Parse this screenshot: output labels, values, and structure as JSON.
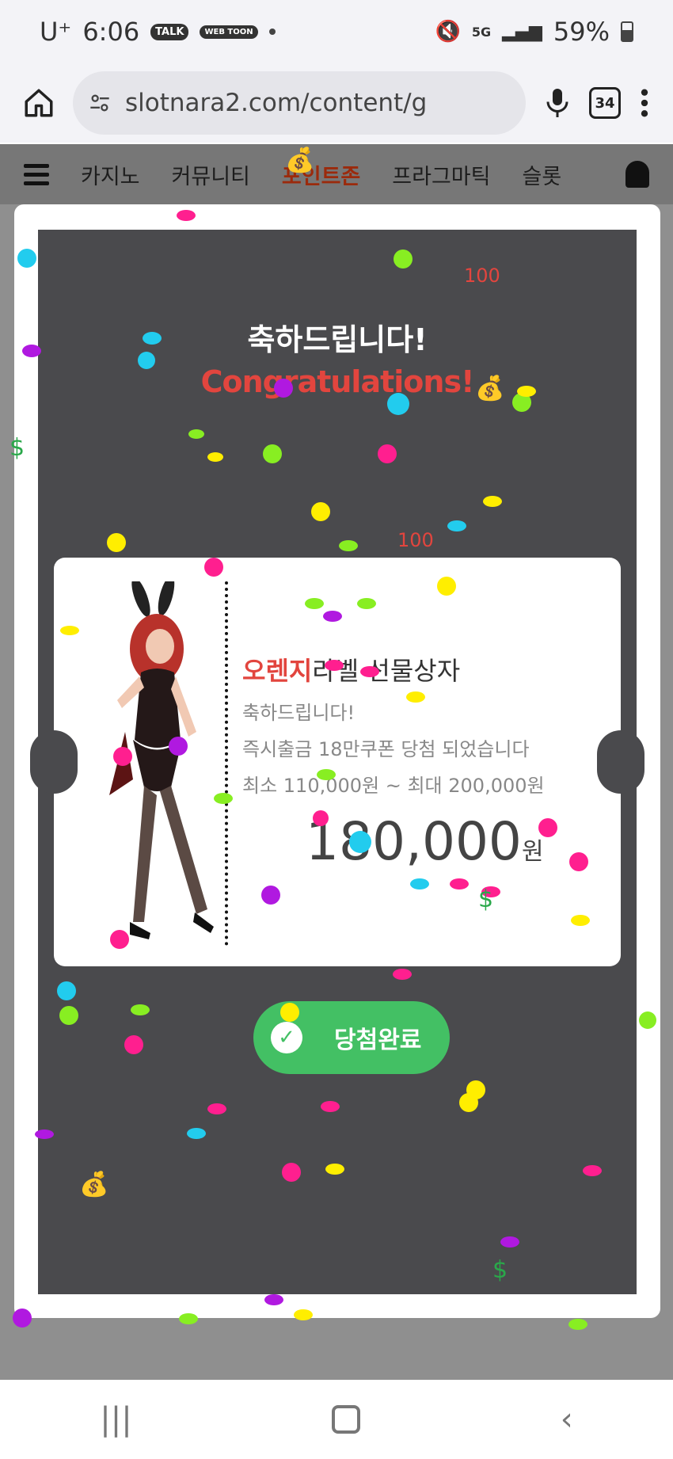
{
  "status_bar": {
    "carrier": "U⁺",
    "time": "6:06",
    "talk_badge": "TALK",
    "webtoon_badge": "WEB TOON",
    "network": "5G",
    "battery": "59%"
  },
  "browser": {
    "url": "slotnara2.com/content/g",
    "tab_count": "34"
  },
  "site_nav": {
    "items": [
      "카지노",
      "커뮤니티",
      "포인트존",
      "프라그마틱",
      "슬롯"
    ],
    "active_index": 2
  },
  "modal": {
    "title_ko": "축하드립니다!",
    "title_en": "Congratulations!",
    "coupon": {
      "title_highlight": "오렌지",
      "title_rest": "라벨 선물상자",
      "line1": "축하드립니다!",
      "line2": "즉시출금 18만쿠폰 당첨 되었습니다",
      "line3": "최소 110,000원 ~ 최대 200,000원",
      "amount": "180,000",
      "currency": "원"
    },
    "button_label": "당첨완료"
  },
  "colors": {
    "accent_red": "#e2453e",
    "button_green": "#43c064",
    "overlay_bg": "#4a4a4d"
  }
}
